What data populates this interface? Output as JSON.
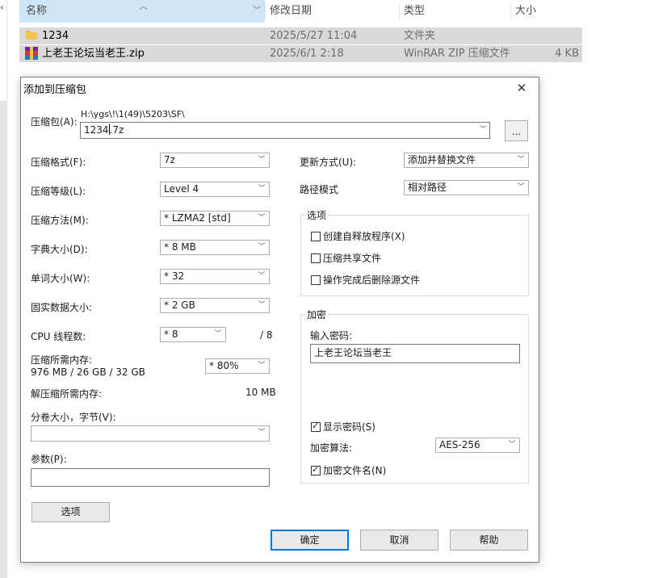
{
  "explorer": {
    "columns": {
      "name": "名称",
      "date": "修改日期",
      "type": "类型",
      "size": "大小"
    },
    "files": [
      {
        "name": "1234",
        "date": "2025/5/27 11:04",
        "type": "文件夹",
        "size": "",
        "icon": "folder-icon"
      },
      {
        "name": "上老王论坛当老王.zip",
        "date": "2025/6/1 2:18",
        "type": "WinRAR ZIP 压缩文件",
        "size": "4 KB",
        "icon": "winrar-zip-icon"
      }
    ]
  },
  "dialog": {
    "title": "添加到压缩包",
    "archive": {
      "label": "压缩包(A):",
      "path": "H:\\ygs\\!\\1(49)\\5203\\SF\\",
      "name_before_caret": "1234",
      "name_after_caret": ".7z",
      "browse_label": "..."
    },
    "format": {
      "label": "压缩格式(F):",
      "value": "7z"
    },
    "level": {
      "label": "压缩等级(L):",
      "value": "Level 4"
    },
    "method": {
      "label": "压缩方法(M):",
      "value": "* LZMA2 [std]"
    },
    "dict": {
      "label": "字典大小(D):",
      "value": "* 8 MB"
    },
    "word": {
      "label": "单词大小(W):",
      "value": "* 32"
    },
    "solid": {
      "label": "固实数据大小:",
      "value": "* 2 GB"
    },
    "threads": {
      "label": "CPU 线程数:",
      "value": "* 8",
      "max": "/ 8"
    },
    "mem_compress": {
      "label": "压缩所需内存:",
      "value": "976 MB / 26 GB / 32 GB",
      "percent": "* 80%"
    },
    "mem_decompress": {
      "label": "解压缩所需内存:",
      "value": "10 MB"
    },
    "volume": {
      "label": "分卷大小，字节(V):",
      "value": ""
    },
    "params": {
      "label": "参数(P):",
      "value": ""
    },
    "options_button": "选项",
    "update": {
      "label": "更新方式(U):",
      "value": "添加并替换文件"
    },
    "path_mode": {
      "label": "路径模式",
      "value": "相对路径"
    },
    "options_group": {
      "title": "选项",
      "items": [
        {
          "label": "创建自释放程序(X)",
          "checked": false
        },
        {
          "label": "压缩共享文件",
          "checked": false
        },
        {
          "label": "操作完成后删除源文件",
          "checked": false
        }
      ]
    },
    "encryption": {
      "title": "加密",
      "password_label": "输入密码:",
      "password_value": "上老王论坛当老王",
      "show_password": {
        "label": "显示密码(S)",
        "checked": true
      },
      "method_label": "加密算法:",
      "method_value": "AES-256",
      "encrypt_names": {
        "label": "加密文件名(N)",
        "checked": true
      }
    },
    "buttons": {
      "ok": "确定",
      "cancel": "取消",
      "help": "帮助"
    }
  }
}
